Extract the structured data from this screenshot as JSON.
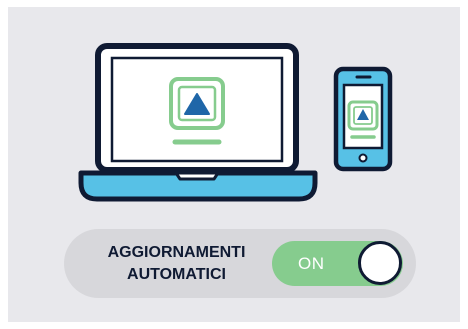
{
  "colors": {
    "outline": "#0f1a33",
    "device_screen_tint": "#57c1e6",
    "screen_bg": "#ffffff",
    "app_icon_outline": "#86cc8e",
    "app_icon_glyph": "#1f66a8",
    "toggle_on": "#86cc8e",
    "toggle_track": "#d7d7db",
    "panel_bg": "#e8e8ec"
  },
  "icons": {
    "laptop": "laptop-icon",
    "phone": "smartphone-icon",
    "app": "upload-triangle-app-icon"
  },
  "setting": {
    "label_line1": "AGGIORNAMENTI",
    "label_line2": "AUTOMATICI",
    "state_label": "ON",
    "enabled": true
  }
}
